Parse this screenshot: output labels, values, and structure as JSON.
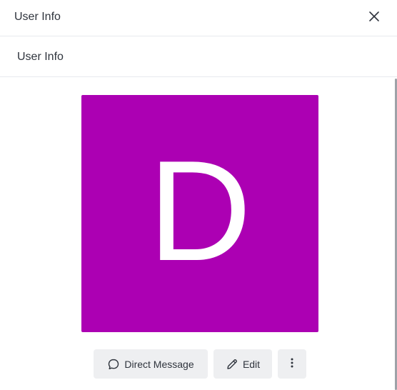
{
  "header": {
    "title": "User Info",
    "close_icon": "close-icon"
  },
  "subheader": {
    "title": "User Info"
  },
  "avatar": {
    "letter": "D",
    "background": "#ac00b3"
  },
  "actions": {
    "direct_message_label": "Direct Message",
    "direct_message_icon": "chat-bubble-icon",
    "edit_label": "Edit",
    "edit_icon": "pencil-icon",
    "more_icon": "kebab-menu-icon"
  }
}
